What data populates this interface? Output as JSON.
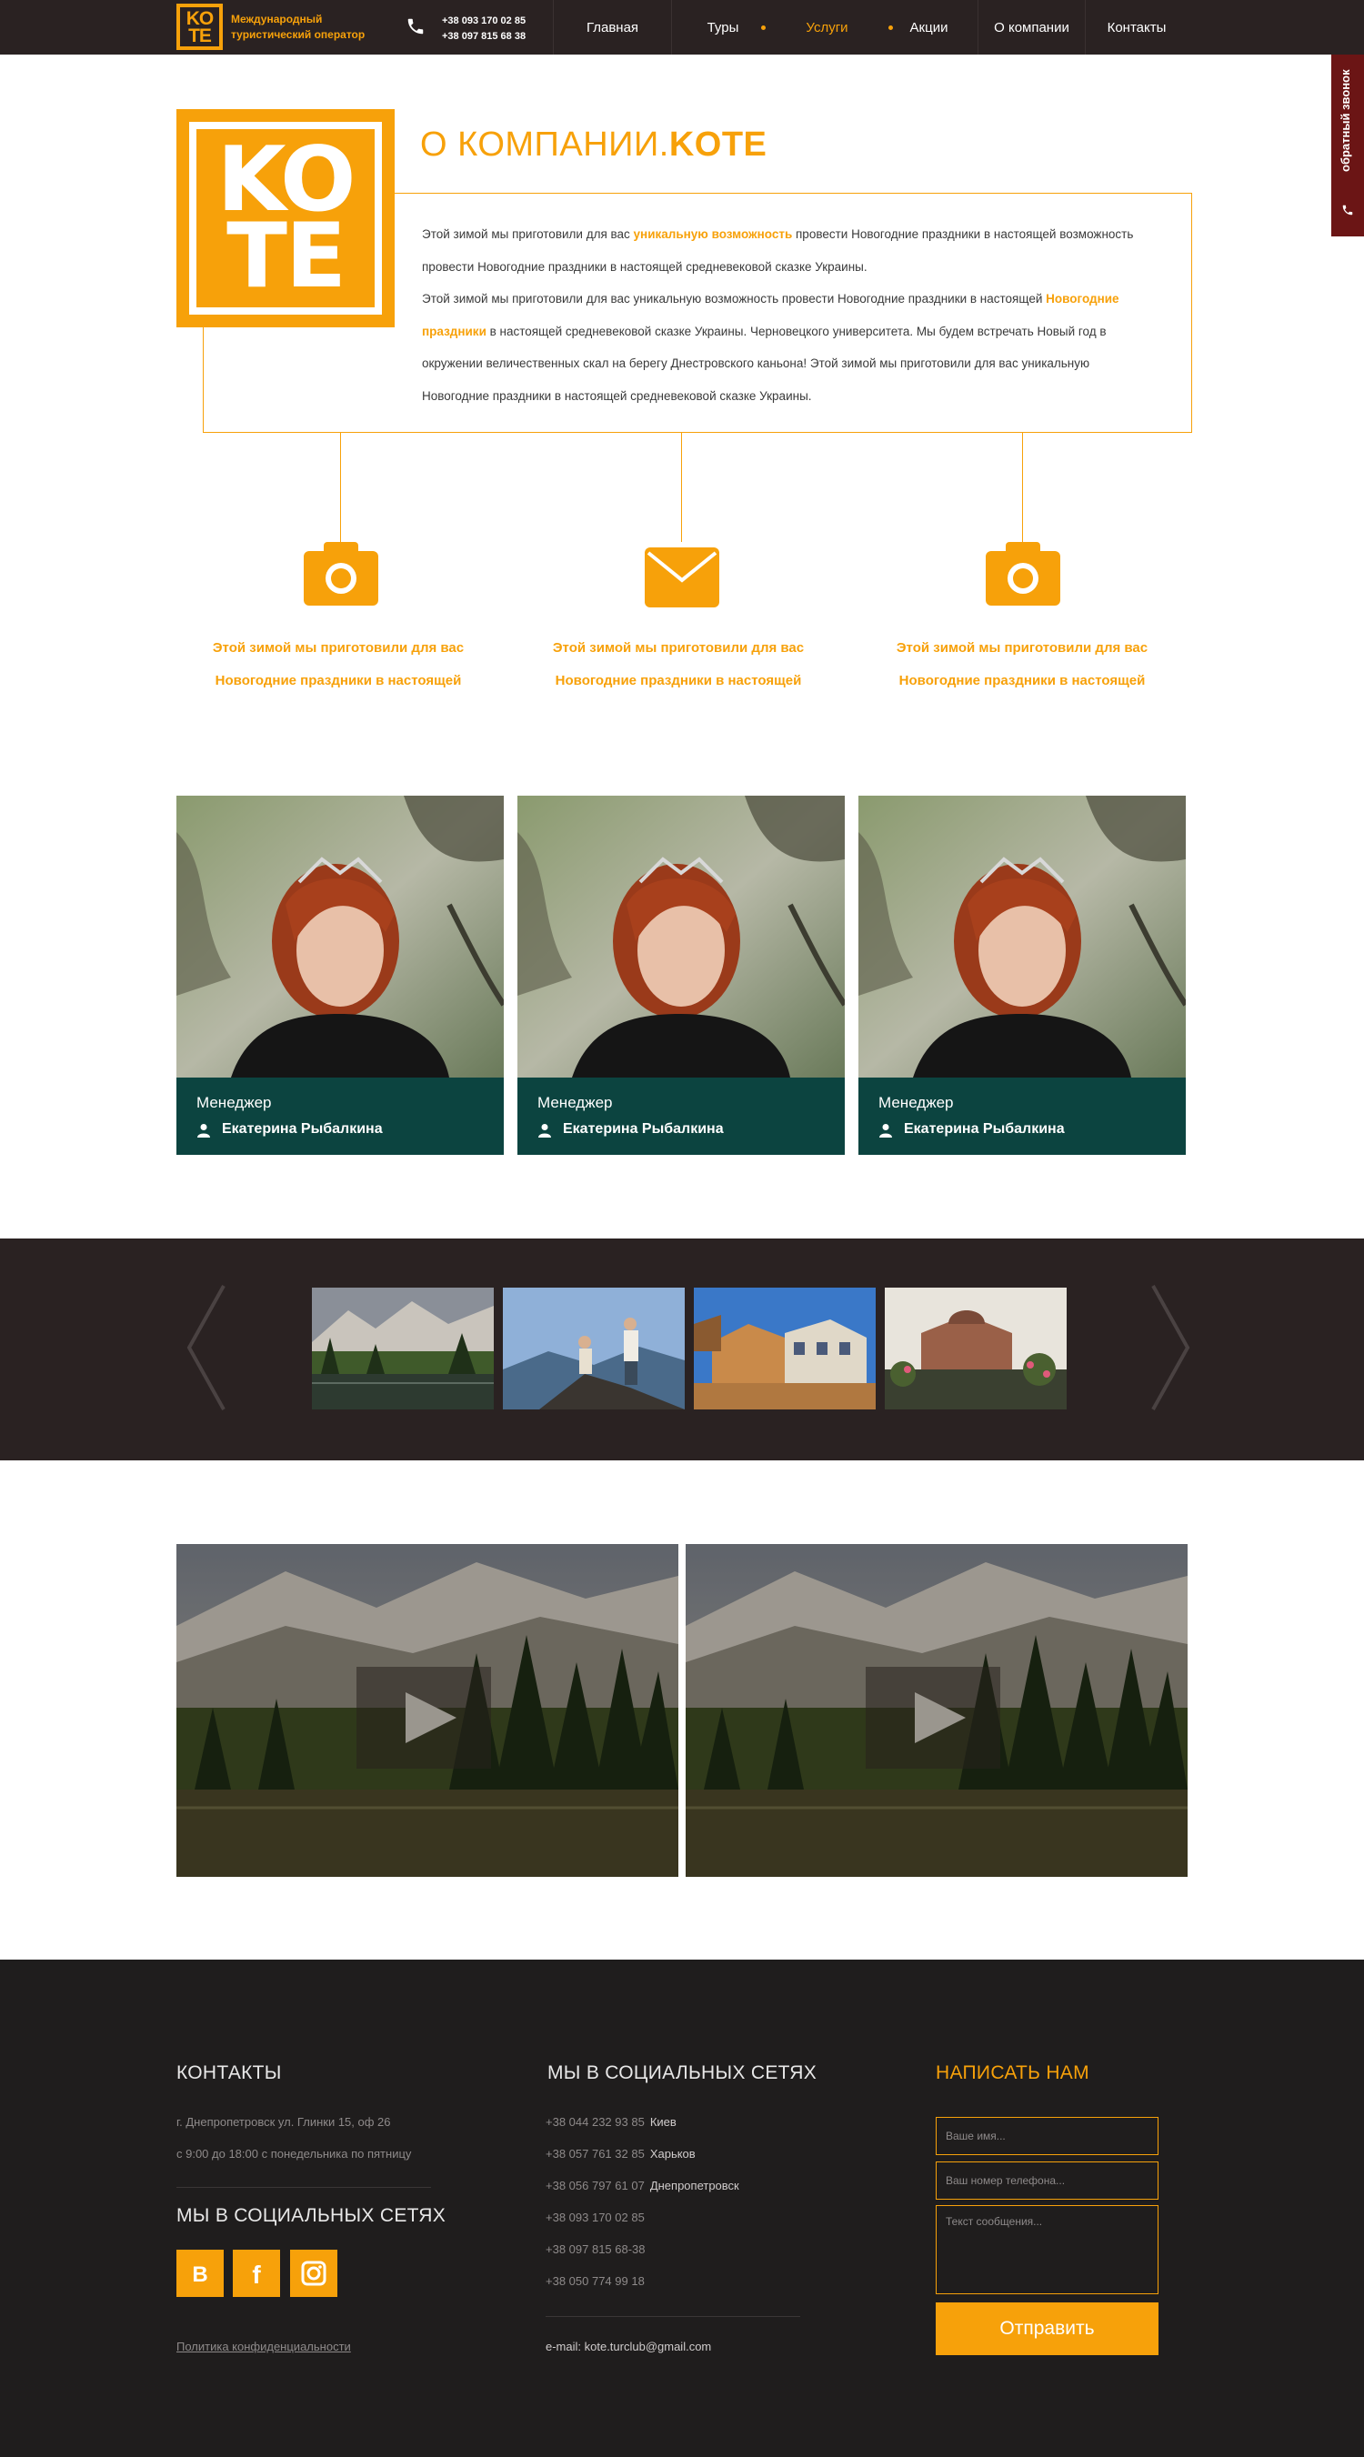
{
  "colors": {
    "accent": "#f7a10a",
    "header_bg": "#2a2222",
    "team_bg": "#0c4440",
    "footer_bg": "#1f1d1d",
    "callback_bg": "#6b1515"
  },
  "header": {
    "logo_top": "KO",
    "logo_bottom": "TE",
    "tagline": "Международный туристический оператор",
    "phone_icon": "phone-icon",
    "phones": [
      "+38 093 170 02 85",
      "+38 097 815 68 38"
    ],
    "nav": [
      {
        "label": "Главная",
        "active": false
      },
      {
        "label": "Туры",
        "active": false
      },
      {
        "label": "Услуги",
        "active": true
      },
      {
        "label": "Акции",
        "active": false
      },
      {
        "label": "О компании",
        "active": false
      },
      {
        "label": "Контакты",
        "active": false
      }
    ]
  },
  "callback": {
    "label": "обратный звонок",
    "icon": "phone-icon"
  },
  "about": {
    "logo_top": "KO",
    "logo_bottom": "TE",
    "title_prefix": "О КОМПАНИИ.",
    "title_brand": "KOTE",
    "p1_a": "Этой зимой мы приготовили для вас ",
    "p1_hl": "уникальную возможность",
    "p1_b": " провести Новогодние праздники в настоящей возможность провести Новогодние праздники в настоящей средневековой сказке Украины.",
    "p2_a": "Этой зимой мы приготовили для вас уникальную возможность провести Новогодние праздники в настоящей ",
    "p2_hl": "Новогодние праздники",
    "p2_b": " в настоящей средневековой сказке Украины. Черновецкого университета. Мы будем встречать Новый год в окружении величественных скал на берегу Днестровского каньона! Этой зимой мы приготовили для вас уникальную Новогодние праздники в настоящей средневековой сказке Украины."
  },
  "features": [
    {
      "icon": "camera-icon",
      "line1": "Этой зимой мы приготовили для вас",
      "line2": "Новогодние праздники в настоящей"
    },
    {
      "icon": "envelope-icon",
      "line1": "Этой зимой мы приготовили для вас",
      "line2": "Новогодние праздники в настоящей"
    },
    {
      "icon": "camera-icon",
      "line1": "Этой зимой мы приготовили для вас",
      "line2": "Новогодние праздники в настоящей"
    }
  ],
  "team": [
    {
      "role": "Менеджер",
      "name": "Екатерина Рыбалкина"
    },
    {
      "role": "Менеджер",
      "name": "Екатерина Рыбалкина"
    },
    {
      "role": "Менеджер",
      "name": "Екатерина Рыбалкина"
    }
  ],
  "gallery": {
    "prev_icon": "chevron-left-icon",
    "next_icon": "chevron-right-icon"
  },
  "videos": {
    "play_icon": "play-icon"
  },
  "footer": {
    "contacts_title": "КОНТАКТЫ",
    "address": "г. Днепропетровск ул. Глинки 15, оф 26",
    "hours": "с 9:00 до 18:00 с понедельника по пятницу",
    "social_title_left": "МЫ В СОЦИАЛЬНЫХ СЕТЯХ",
    "social": [
      {
        "label": "В",
        "icon": "vk-icon"
      },
      {
        "label": "f",
        "icon": "facebook-icon"
      },
      {
        "label": "",
        "icon": "instagram-icon"
      }
    ],
    "privacy": "Политика конфиденциальности",
    "social_title_mid": "МЫ В СОЦИАЛЬНЫХ СЕТЯХ",
    "phones": [
      {
        "num": "+38 044 232 93 85",
        "city": "Киев"
      },
      {
        "num": "+38 057 761 32 85",
        "city": "Харьков"
      },
      {
        "num": "+38 056 797 61 07",
        "city": "Днепропетровск"
      },
      {
        "num": "+38 093 170 02 85",
        "city": ""
      },
      {
        "num": "+38 097 815 68-38",
        "city": ""
      },
      {
        "num": "+38 050 774 99 18",
        "city": ""
      }
    ],
    "email": "e-mail: kote.turclub@gmail.com",
    "form_title": "НАПИСАТЬ НАМ",
    "name_placeholder": "Ваше имя...",
    "phone_placeholder": "Ваш номер телефона...",
    "message_placeholder": "Текст сообщения...",
    "submit": "Отправить"
  }
}
